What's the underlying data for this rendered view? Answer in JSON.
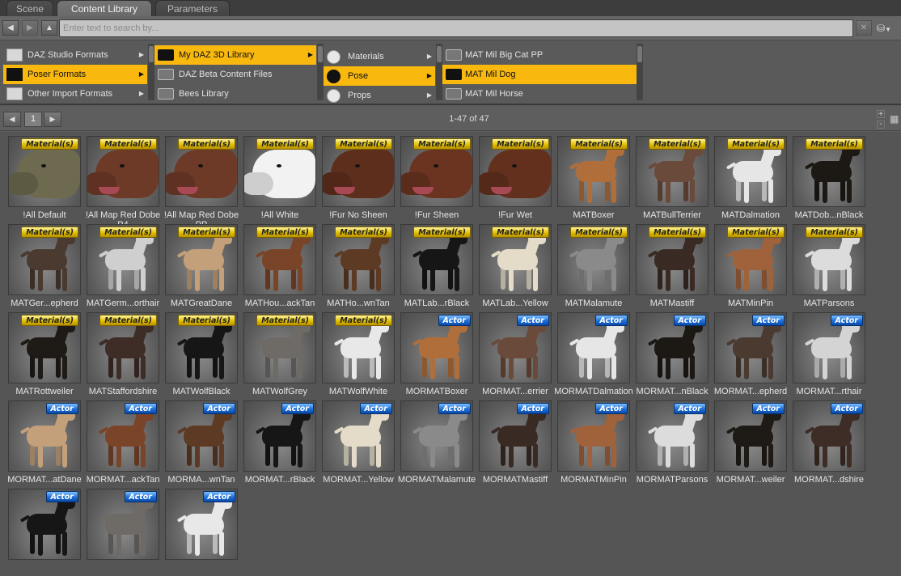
{
  "tabs": [
    {
      "label": "Scene",
      "active": false
    },
    {
      "label": "Content Library",
      "active": true
    },
    {
      "label": "Parameters",
      "active": false
    }
  ],
  "search": {
    "placeholder": "Enter text to search by..."
  },
  "browser": {
    "col1": [
      {
        "label": "DAZ Studio Formats",
        "icon": "daz-formats-icon",
        "selected": false
      },
      {
        "label": "Poser Formats",
        "icon": "poser-formats-icon",
        "selected": true
      },
      {
        "label": "Other Import Formats",
        "icon": "import-formats-icon",
        "selected": false
      }
    ],
    "col2": [
      {
        "label": "My DAZ 3D Library",
        "selected": true
      },
      {
        "label": "DAZ Beta Content Files",
        "selected": false
      },
      {
        "label": "Bees Library",
        "selected": false
      }
    ],
    "col3": [
      {
        "label": "Materials",
        "icon": "materials-icon",
        "selected": false
      },
      {
        "label": "Pose",
        "icon": "pose-icon",
        "selected": true
      },
      {
        "label": "Props",
        "icon": "props-icon",
        "selected": false
      }
    ],
    "col4": [
      {
        "label": "MAT Mil Big Cat PP",
        "selected": false
      },
      {
        "label": "MAT Mil Dog",
        "selected": true
      },
      {
        "label": "MAT Mil Horse",
        "selected": false
      }
    ]
  },
  "paging": {
    "page": "1",
    "count": "1-47 of 47"
  },
  "colors": {
    "selection": "#f8b80e",
    "material_badge": "#e3c000",
    "actor_badge": "#1d6fd6"
  },
  "badges": {
    "material": "Material(s)",
    "actor": "Actor"
  },
  "items": [
    {
      "label": "!All Default",
      "badge": "material",
      "kind": "head",
      "coat": "#6d6a4f"
    },
    {
      "label": "!All Map Red Dobe P4",
      "badge": "material",
      "kind": "head",
      "coat": "#6e3a28"
    },
    {
      "label": "!All Map Red Dobe PP",
      "badge": "material",
      "kind": "head",
      "coat": "#6e3a28"
    },
    {
      "label": "!All White",
      "badge": "material",
      "kind": "head",
      "coat": "#f2f2f2"
    },
    {
      "label": "!Fur No Sheen",
      "badge": "material",
      "kind": "head",
      "coat": "#5e2e1c"
    },
    {
      "label": "!Fur Sheen",
      "badge": "material",
      "kind": "head",
      "coat": "#6a3420"
    },
    {
      "label": "!Fur Wet",
      "badge": "material",
      "kind": "head",
      "coat": "#64301e"
    },
    {
      "label": "MATBoxer",
      "badge": "material",
      "kind": "full",
      "coat": "#b06e3a"
    },
    {
      "label": "MATBullTerrier",
      "badge": "material",
      "kind": "full",
      "coat": "#6a4a3a"
    },
    {
      "label": "MATDalmation",
      "badge": "material",
      "kind": "full",
      "coat": "#e6e6e6"
    },
    {
      "label": "MATDob...nBlack",
      "badge": "material",
      "kind": "full",
      "coat": "#1c1814"
    },
    {
      "label": "MATGer...epherd",
      "badge": "material",
      "kind": "full",
      "coat": "#4a3a30"
    },
    {
      "label": "MATGerm...orthair",
      "badge": "material",
      "kind": "full",
      "coat": "#cfcfcf"
    },
    {
      "label": "MATGreatDane",
      "badge": "material",
      "kind": "full",
      "coat": "#c4a07a"
    },
    {
      "label": "MATHou...ackTan",
      "badge": "material",
      "kind": "full",
      "coat": "#7a4428"
    },
    {
      "label": "MATHo...wnTan",
      "badge": "material",
      "kind": "full",
      "coat": "#5c3a24"
    },
    {
      "label": "MATLab...rBlack",
      "badge": "material",
      "kind": "full",
      "coat": "#161616"
    },
    {
      "label": "MATLab...Yellow",
      "badge": "material",
      "kind": "full",
      "coat": "#e4dcc8"
    },
    {
      "label": "MATMalamute",
      "badge": "material",
      "kind": "full",
      "coat": "#8a8a8a"
    },
    {
      "label": "MATMastiff",
      "badge": "material",
      "kind": "full",
      "coat": "#3a2a24"
    },
    {
      "label": "MATMinPin",
      "badge": "material",
      "kind": "full",
      "coat": "#a0623a"
    },
    {
      "label": "MATParsons",
      "badge": "material",
      "kind": "full",
      "coat": "#dcdcdc"
    },
    {
      "label": "MATRottweiler",
      "badge": "material",
      "kind": "full",
      "coat": "#1e1a16"
    },
    {
      "label": "MATStaffordshire",
      "badge": "material",
      "kind": "full",
      "coat": "#3e2c26"
    },
    {
      "label": "MATWolfBlack",
      "badge": "material",
      "kind": "full",
      "coat": "#161616"
    },
    {
      "label": "MATWolfGrey",
      "badge": "material",
      "kind": "full",
      "coat": "#6e6a66"
    },
    {
      "label": "MATWolfWhite",
      "badge": "material",
      "kind": "full",
      "coat": "#e8e8e8"
    },
    {
      "label": "MORMATBoxer",
      "badge": "actor",
      "kind": "full",
      "coat": "#b06e3a"
    },
    {
      "label": "MORMAT...errier",
      "badge": "actor",
      "kind": "full",
      "coat": "#6a4a3a"
    },
    {
      "label": "MORMATDalmation",
      "badge": "actor",
      "kind": "full",
      "coat": "#e6e6e6"
    },
    {
      "label": "MORMAT...nBlack",
      "badge": "actor",
      "kind": "full",
      "coat": "#1c1814"
    },
    {
      "label": "MORMAT...epherd",
      "badge": "actor",
      "kind": "full",
      "coat": "#4a3a30"
    },
    {
      "label": "MORMAT...rthair",
      "badge": "actor",
      "kind": "full",
      "coat": "#d4d4d4"
    },
    {
      "label": "MORMAT...atDane",
      "badge": "actor",
      "kind": "full",
      "coat": "#c4a07a"
    },
    {
      "label": "MORMAT...ackTan",
      "badge": "actor",
      "kind": "full",
      "coat": "#7a4428"
    },
    {
      "label": "MORMA...wnTan",
      "badge": "actor",
      "kind": "full",
      "coat": "#5c3a24"
    },
    {
      "label": "MORMAT...rBlack",
      "badge": "actor",
      "kind": "full",
      "coat": "#161616"
    },
    {
      "label": "MORMAT...Yellow",
      "badge": "actor",
      "kind": "full",
      "coat": "#e4dcc8"
    },
    {
      "label": "MORMATMalamute",
      "badge": "actor",
      "kind": "full",
      "coat": "#8a8a8a"
    },
    {
      "label": "MORMATMastiff",
      "badge": "actor",
      "kind": "full",
      "coat": "#3a2a24"
    },
    {
      "label": "MORMATMinPin",
      "badge": "actor",
      "kind": "full",
      "coat": "#a0623a"
    },
    {
      "label": "MORMATParsons",
      "badge": "actor",
      "kind": "full",
      "coat": "#dcdcdc"
    },
    {
      "label": "MORMAT...weiler",
      "badge": "actor",
      "kind": "full",
      "coat": "#1e1a16"
    },
    {
      "label": "MORMAT...dshire",
      "badge": "actor",
      "kind": "full",
      "coat": "#3e2c26"
    },
    {
      "label": "",
      "badge": "actor",
      "kind": "full",
      "coat": "#161616"
    },
    {
      "label": "",
      "badge": "actor",
      "kind": "full",
      "coat": "#6e6a66"
    },
    {
      "label": "",
      "badge": "actor",
      "kind": "full",
      "coat": "#e8e8e8"
    }
  ]
}
